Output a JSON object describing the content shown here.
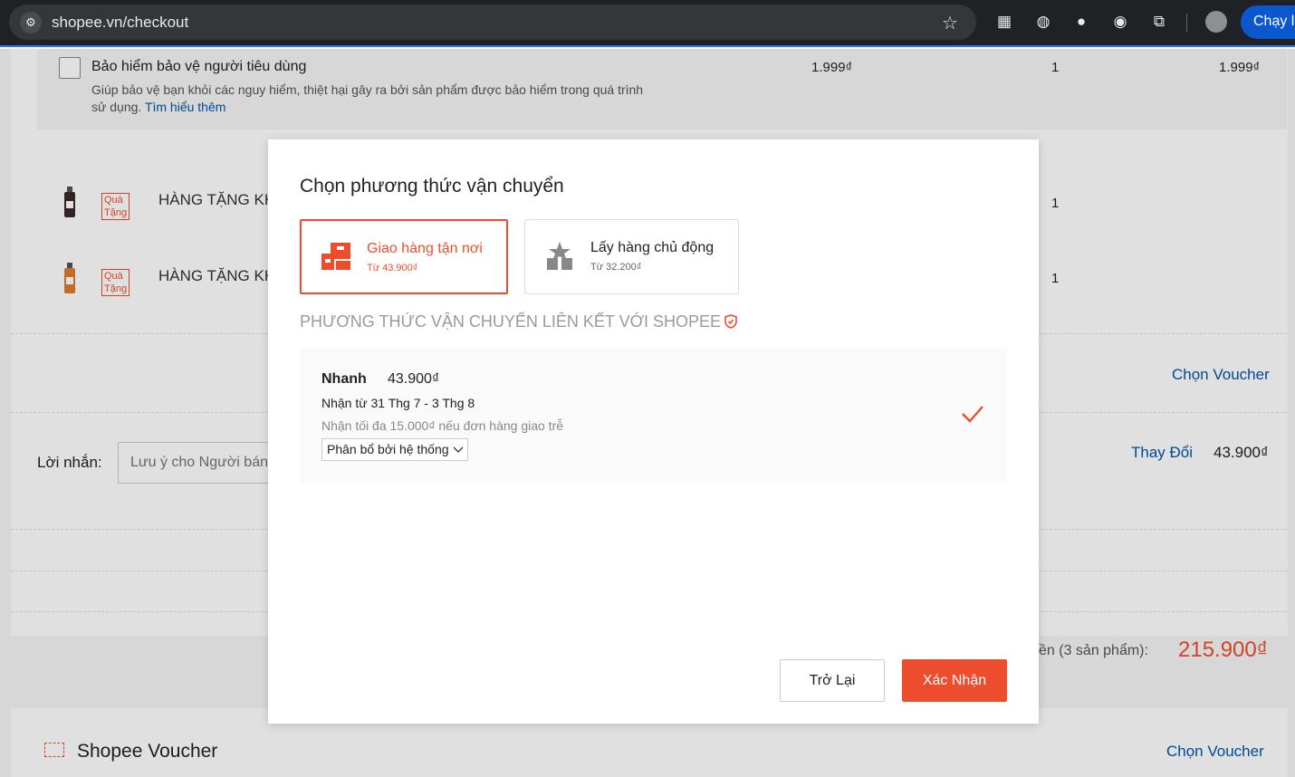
{
  "browser": {
    "url": "shopee.vn/checkout",
    "run_button": "Chạy l"
  },
  "background": {
    "insurance": {
      "title": "Bảo hiểm bảo vệ người tiêu dùng",
      "desc": "Giúp bảo vệ bạn khỏi các nguy hiểm, thiệt hại gây ra bởi sản phẩm được bảo hiểm trong quá trình sử dụng.",
      "learn_more": "Tìm hiểu thêm",
      "price": "1.999₫",
      "qty": "1",
      "total": "1.999₫"
    },
    "gifts": [
      {
        "tag": "Quà Tặng",
        "name": "HÀNG TẶNG KH",
        "qty": "1"
      },
      {
        "tag": "Quà Tặng",
        "name": "HÀNG TẶNG KH",
        "qty": "1"
      }
    ],
    "choose_voucher": "Chọn Voucher",
    "message_label": "Lời nhắn:",
    "message_placeholder": "Lưu ý cho Người bán...",
    "change_link": "Thay Đổi",
    "shipping_fee": "43.900₫",
    "total_label": "ền (3 sản phẩm):",
    "total_value": "215.900₫",
    "shopee_voucher": "Shopee Voucher",
    "shopee_voucher_link": "Chọn Voucher"
  },
  "modal": {
    "title": "Chọn phương thức vận chuyển",
    "options": [
      {
        "label": "Giao hàng tận nơi",
        "sub": "Từ 43.900₫",
        "icon": "delivery-truck-icon",
        "active": true
      },
      {
        "label": "Lấy hàng chủ động",
        "sub": "Từ 32.200₫",
        "icon": "pickup-box-icon",
        "active": false
      }
    ],
    "section_heading": "PHƯƠNG THỨC VẬN CHUYỂN LIÊN KẾT VỚI SHOPEE",
    "method": {
      "name": "Nhanh",
      "price": "43.900₫",
      "eta": "Nhận từ 31 Thg 7 - 3 Thg 8",
      "note": "Nhận tối đa 15.000₫ nếu đơn hàng giao trễ",
      "carrier_select": "Phân bổ bởi hệ thống"
    },
    "back_button": "Trở Lại",
    "confirm_button": "Xác Nhận"
  },
  "colors": {
    "accent": "#ee4d2d",
    "link": "#0055aa"
  }
}
